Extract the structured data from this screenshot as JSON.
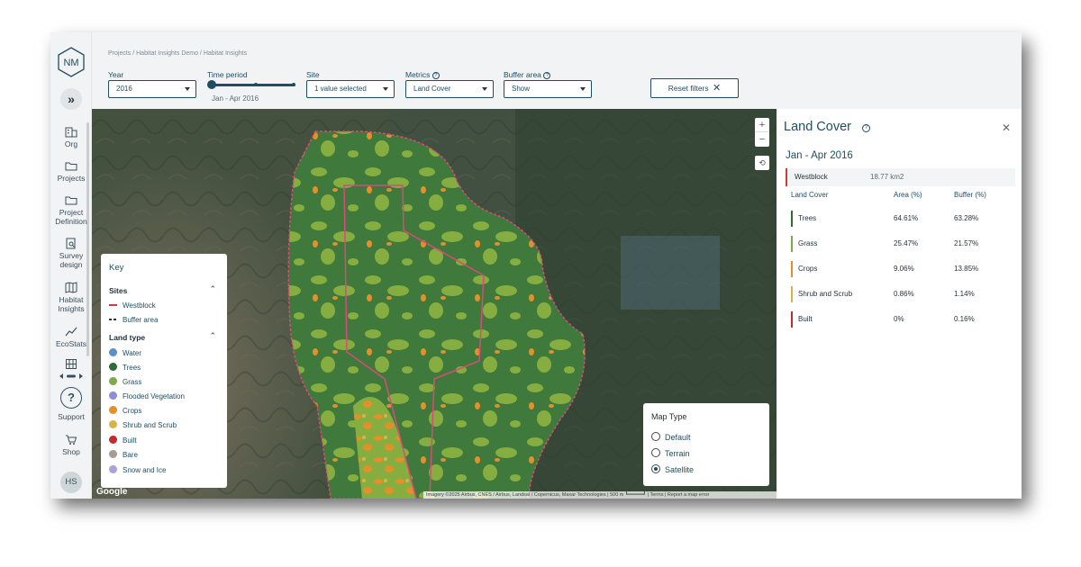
{
  "sidebar": {
    "logo_text": "NM",
    "expand_label": "»",
    "items": [
      {
        "label": "Org",
        "icon": "building-icon"
      },
      {
        "label": "Projects",
        "icon": "folder-icon"
      },
      {
        "label": "Project\nDefinition",
        "icon": "folder-icon"
      },
      {
        "label": "Survey\ndesign",
        "icon": "clipboard-search-icon"
      },
      {
        "label": "Habitat\nInsights",
        "icon": "map-icon"
      },
      {
        "label": "EcoStats",
        "icon": "trend-icon"
      }
    ],
    "support_label": "Support",
    "support_glyph": "?",
    "shop_label": "Shop",
    "avatar_initials": "HS"
  },
  "breadcrumb": "Projects / Habitat Insights Demo / Habitat Insights",
  "filters": {
    "year": {
      "label": "Year",
      "value": "2016"
    },
    "time_period": {
      "label": "Time period",
      "value": "Jan - Apr 2016"
    },
    "site": {
      "label": "Site",
      "value": "1 value selected"
    },
    "metrics": {
      "label": "Metrics",
      "value": "Land Cover"
    },
    "buffer": {
      "label": "Buffer area",
      "value": "Show"
    },
    "reset_label": "Reset filters"
  },
  "map": {
    "zoom_in": "+",
    "zoom_out": "−",
    "google_label": "Google",
    "attribution": "Imagery ©2025 Airbus, CNES / Airbus, Landsat / Copernicus, Maxar Technologies | 500 m ┗━━━━━┛ | Terms | Report a map error",
    "key": {
      "title": "Key",
      "sites_heading": "Sites",
      "sites": [
        {
          "label": "Westblock",
          "color": "#d23a3a",
          "style": "solid"
        },
        {
          "label": "Buffer area",
          "color": "#333333",
          "style": "dashed"
        }
      ],
      "land_heading": "Land type",
      "land_types": [
        {
          "label": "Water",
          "color": "#5a8fc9"
        },
        {
          "label": "Trees",
          "color": "#2e6b36"
        },
        {
          "label": "Grass",
          "color": "#7fa84b"
        },
        {
          "label": "Flooded Vegetation",
          "color": "#8a8fd6"
        },
        {
          "label": "Crops",
          "color": "#e2902b"
        },
        {
          "label": "Shrub and Scrub",
          "color": "#d8b34a"
        },
        {
          "label": "Built",
          "color": "#c22c2c"
        },
        {
          "label": "Bare",
          "color": "#a59c94"
        },
        {
          "label": "Snow and Ice",
          "color": "#a9a3d9"
        }
      ]
    },
    "map_type": {
      "title": "Map Type",
      "options": [
        "Default",
        "Terrain",
        "Satellite"
      ],
      "selected": "Satellite"
    }
  },
  "panel": {
    "title": "Land Cover",
    "period": "Jan - Apr 2016",
    "site_name": "Westblock",
    "site_area": "18.77 km2",
    "headers": {
      "land_cover": "Land Cover",
      "area": "Area (%)",
      "buffer": "Buffer (%)"
    },
    "rows": [
      {
        "label": "Trees",
        "area": "64.61%",
        "buffer": "63.28%",
        "color": "#2e6b36"
      },
      {
        "label": "Grass",
        "area": "25.47%",
        "buffer": "21.57%",
        "color": "#7fa84b"
      },
      {
        "label": "Crops",
        "area": "9.06%",
        "buffer": "13.85%",
        "color": "#e2902b"
      },
      {
        "label": "Shrub and Scrub",
        "area": "0.86%",
        "buffer": "1.14%",
        "color": "#d8b34a"
      },
      {
        "label": "Built",
        "area": "0%",
        "buffer": "0.16%",
        "color": "#c22c2c"
      }
    ]
  }
}
